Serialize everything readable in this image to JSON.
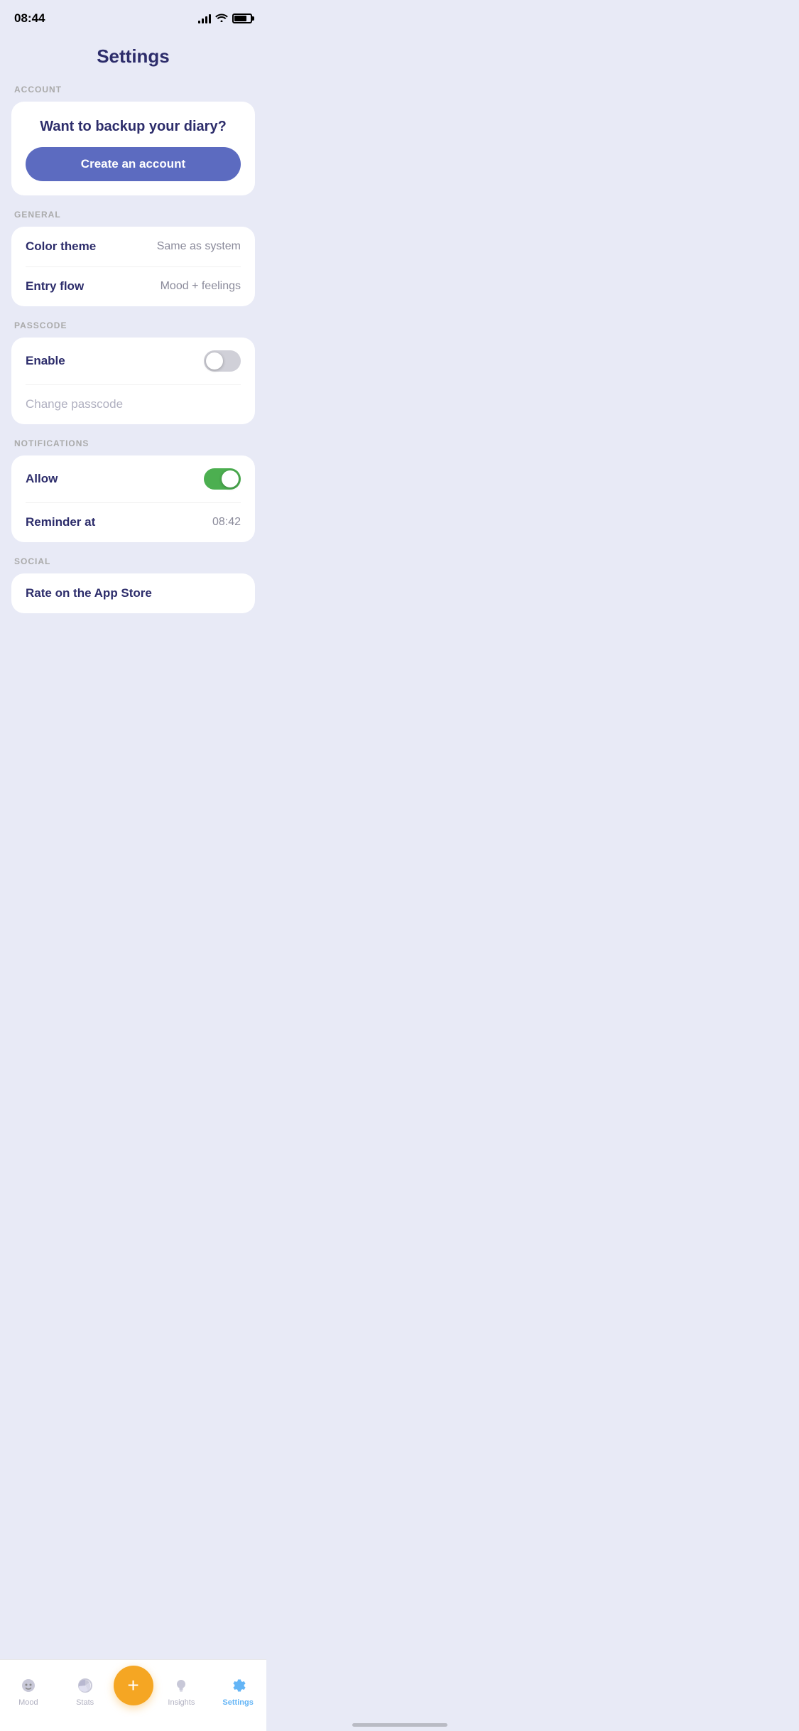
{
  "statusBar": {
    "time": "08:44"
  },
  "pageTitle": "Settings",
  "sections": {
    "account": {
      "label": "ACCOUNT",
      "backupText": "Want to backup your diary?",
      "createAccountBtn": "Create an account"
    },
    "general": {
      "label": "GENERAL",
      "rows": [
        {
          "label": "Color theme",
          "value": "Same as system"
        },
        {
          "label": "Entry flow",
          "value": "Mood + feelings"
        }
      ]
    },
    "passcode": {
      "label": "PASSCODE",
      "rows": [
        {
          "label": "Enable",
          "toggleState": "off"
        },
        {
          "label": "Change passcode",
          "disabled": true
        }
      ]
    },
    "notifications": {
      "label": "NOTIFICATIONS",
      "rows": [
        {
          "label": "Allow",
          "toggleState": "on"
        },
        {
          "label": "Reminder at",
          "value": "08:42"
        }
      ]
    },
    "social": {
      "label": "SOCIAL",
      "rows": [
        {
          "label": "Rate on the App Store"
        }
      ]
    }
  },
  "tabBar": {
    "items": [
      {
        "label": "Mood",
        "active": false,
        "key": "mood"
      },
      {
        "label": "Stats",
        "active": false,
        "key": "stats"
      },
      {
        "label": "Insights",
        "active": false,
        "key": "insights"
      },
      {
        "label": "Settings",
        "active": true,
        "key": "settings"
      }
    ],
    "fabLabel": "+"
  }
}
